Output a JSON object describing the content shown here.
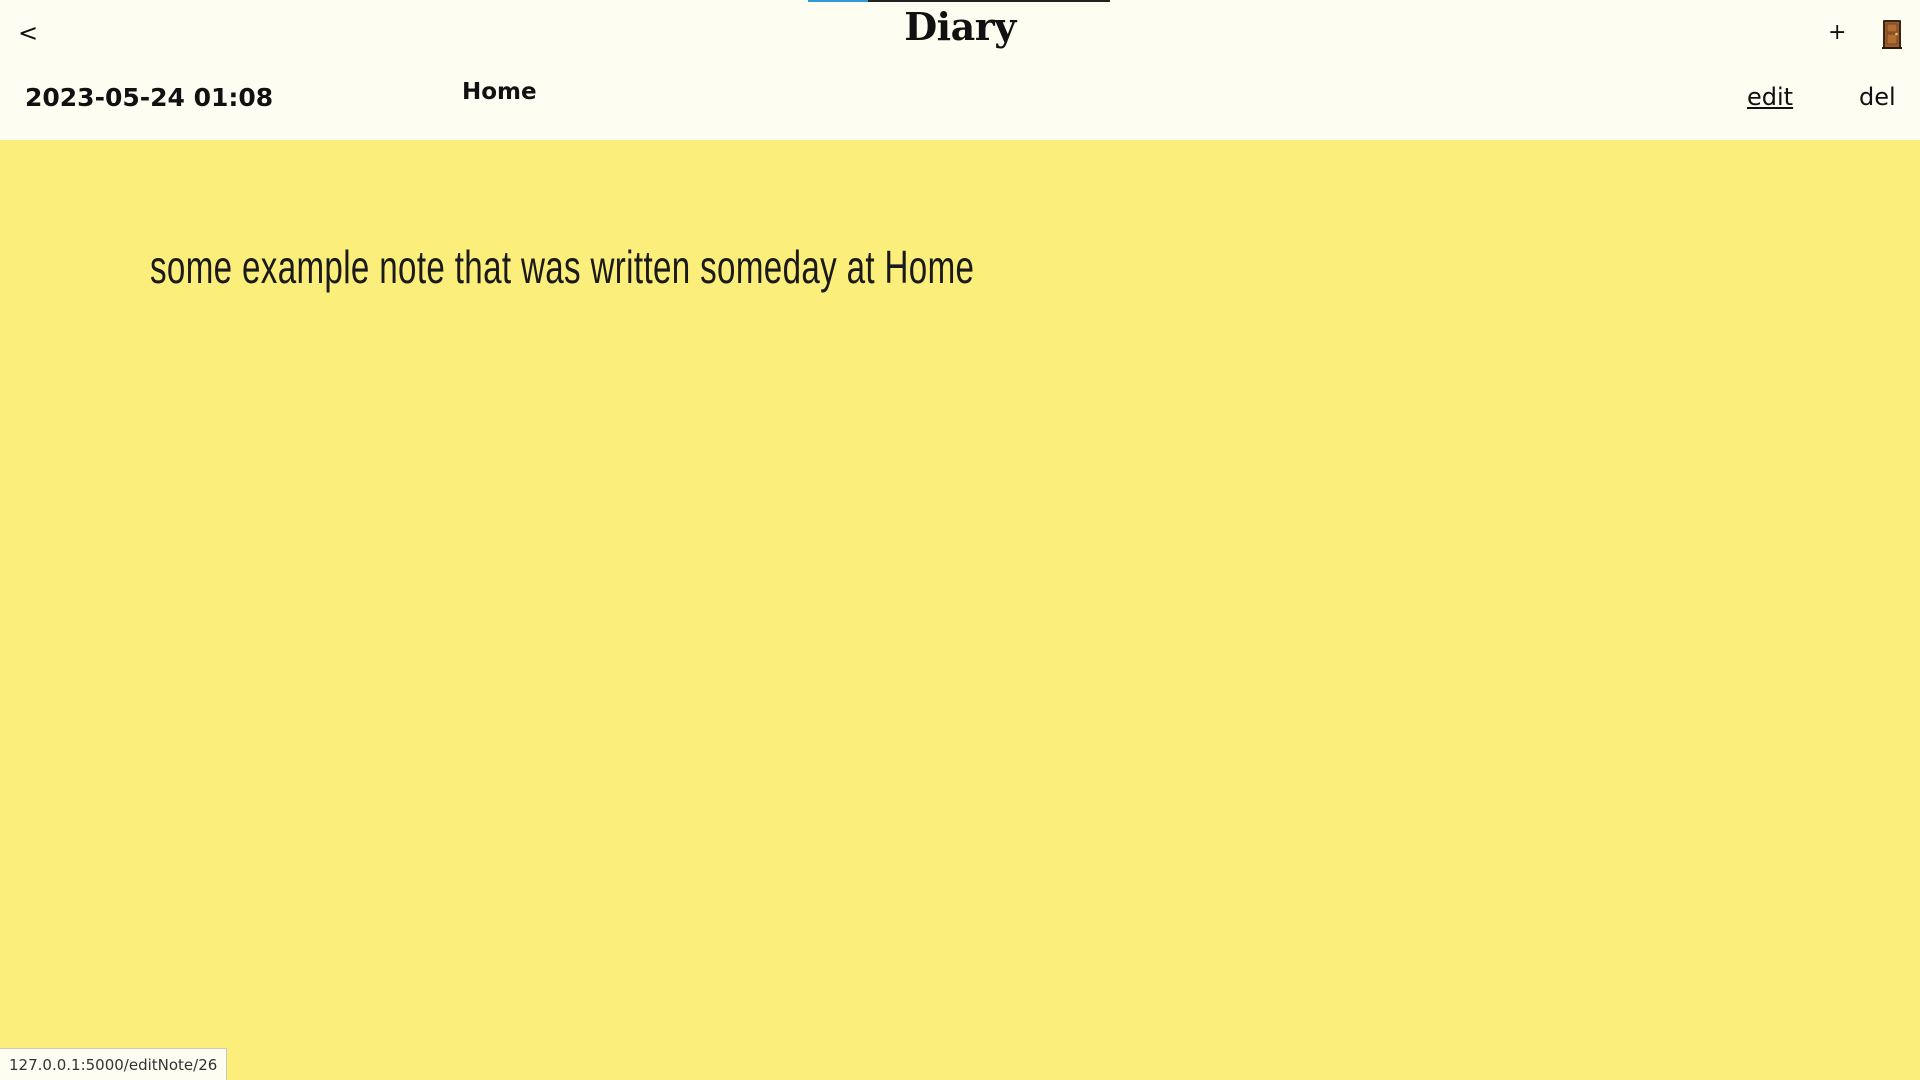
{
  "header": {
    "title": "Diary",
    "back_label": "<",
    "add_label": "+",
    "exit_icon": "door-icon",
    "loading_progress": 0.2
  },
  "note": {
    "date": "2023-05-24 01:08",
    "location": "Home",
    "edit_label": "edit",
    "delete_label": "del",
    "text": "some example note that was written someday at Home"
  },
  "status_bar": {
    "url": "127.0.0.1:5000/editNote/26"
  },
  "colors": {
    "header_bg": "#fefdf1",
    "note_bg": "#fbee7a",
    "progress": "#2e9bd8"
  }
}
